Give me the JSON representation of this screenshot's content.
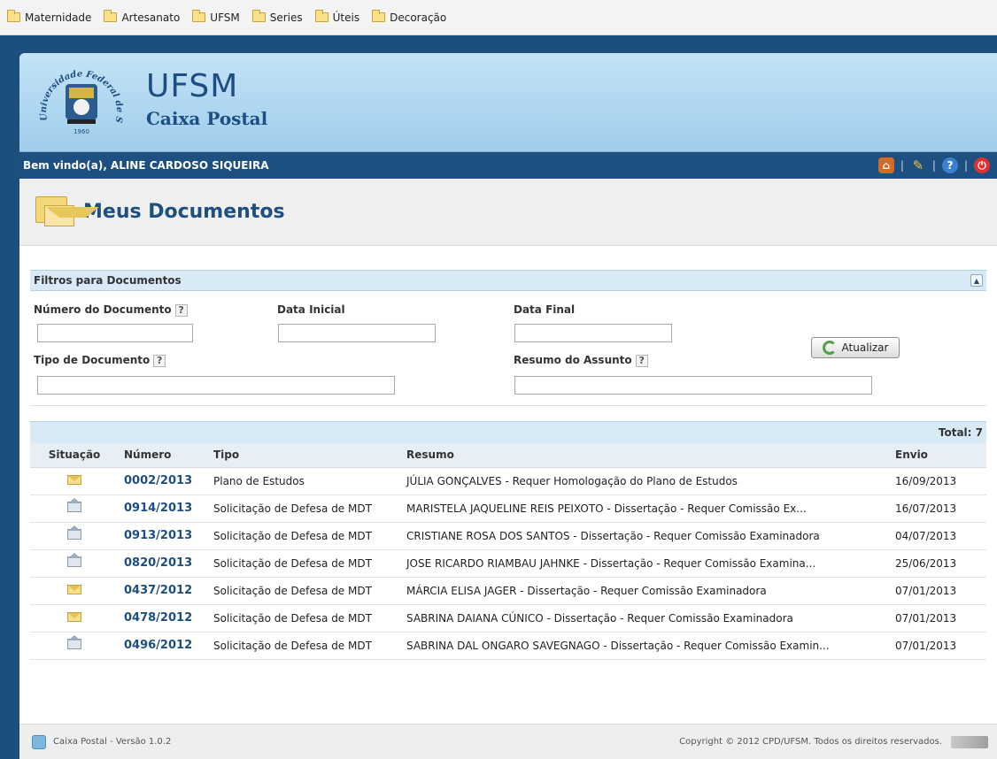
{
  "bookmarks": [
    "Maternidade",
    "Artesanato",
    "UFSM",
    "Series",
    "Úteis",
    "Decoração"
  ],
  "header": {
    "seal": {
      "top": "Federal de",
      "left": "Universidade",
      "right": "Santa Maria",
      "year": "1960"
    },
    "title": "UFSM",
    "subtitle": "Caixa Postal"
  },
  "welcome": {
    "prefix": "Bem vindo(a),",
    "user": "ALINE CARDOSO SIQUEIRA"
  },
  "toolbar_icons": [
    "home-icon",
    "tools-icon",
    "help-icon",
    "logout-icon"
  ],
  "page_title": "Meus Documentos",
  "filters": {
    "title": "Filtros para Documentos",
    "numero_label": "Número do Documento",
    "data_inicial_label": "Data Inicial",
    "data_final_label": "Data Final",
    "tipo_label": "Tipo de Documento",
    "resumo_label": "Resumo do Assunto",
    "help": "?",
    "numero_value": "",
    "data_inicial_value": "",
    "data_final_value": "",
    "tipo_value": "",
    "resumo_value": "",
    "button": "Atualizar"
  },
  "results": {
    "total": "Total: 7",
    "columns": {
      "situacao": "Situação",
      "numero": "Número",
      "tipo": "Tipo",
      "resumo": "Resumo",
      "envio": "Envio"
    },
    "rows": [
      {
        "situacao": "novo",
        "numero": "0002/2013",
        "tipo": "Plano de Estudos",
        "resumo": "JÚLIA GONÇALVES - Requer Homologação do Plano de Estudos",
        "envio": "16/09/2013"
      },
      {
        "situacao": "lido",
        "numero": "0914/2013",
        "tipo": "Solicitação de Defesa de MDT",
        "resumo": "MARISTELA JAQUELINE REIS PEIXOTO - Dissertação - Requer Comissão Ex...",
        "envio": "16/07/2013"
      },
      {
        "situacao": "lido",
        "numero": "0913/2013",
        "tipo": "Solicitação de Defesa de MDT",
        "resumo": "CRISTIANE ROSA DOS SANTOS - Dissertação - Requer Comissão Examinadora",
        "envio": "04/07/2013"
      },
      {
        "situacao": "lido",
        "numero": "0820/2013",
        "tipo": "Solicitação de Defesa de MDT",
        "resumo": "JOSE RICARDO RIAMBAU JAHNKE - Dissertação - Requer Comissão Examina...",
        "envio": "25/06/2013"
      },
      {
        "situacao": "novo",
        "numero": "0437/2012",
        "tipo": "Solicitação de Defesa de MDT",
        "resumo": "MÁRCIA ELISA JAGER - Dissertação - Requer Comissão Examinadora",
        "envio": "07/01/2013"
      },
      {
        "situacao": "novo",
        "numero": "0478/2012",
        "tipo": "Solicitação de Defesa de MDT",
        "resumo": "SABRINA DAIANA CÚNICO - Dissertação - Requer Comissão Examinadora",
        "envio": "07/01/2013"
      },
      {
        "situacao": "lido",
        "numero": "0496/2012",
        "tipo": "Solicitação de Defesa de MDT",
        "resumo": "SABRINA DAL ONGARO SAVEGNAGO - Dissertação - Requer Comissão Examin...",
        "envio": "07/01/2013"
      }
    ]
  },
  "footer": {
    "version": "Caixa Postal - Versão 1.0.2",
    "copyright": "Copyright © 2012 CPD/UFSM. Todos os direitos reservados."
  },
  "colors": {
    "brand": "#1d4f80",
    "header_bg": "#a9d3ef",
    "panel": "#d9eaf7"
  }
}
